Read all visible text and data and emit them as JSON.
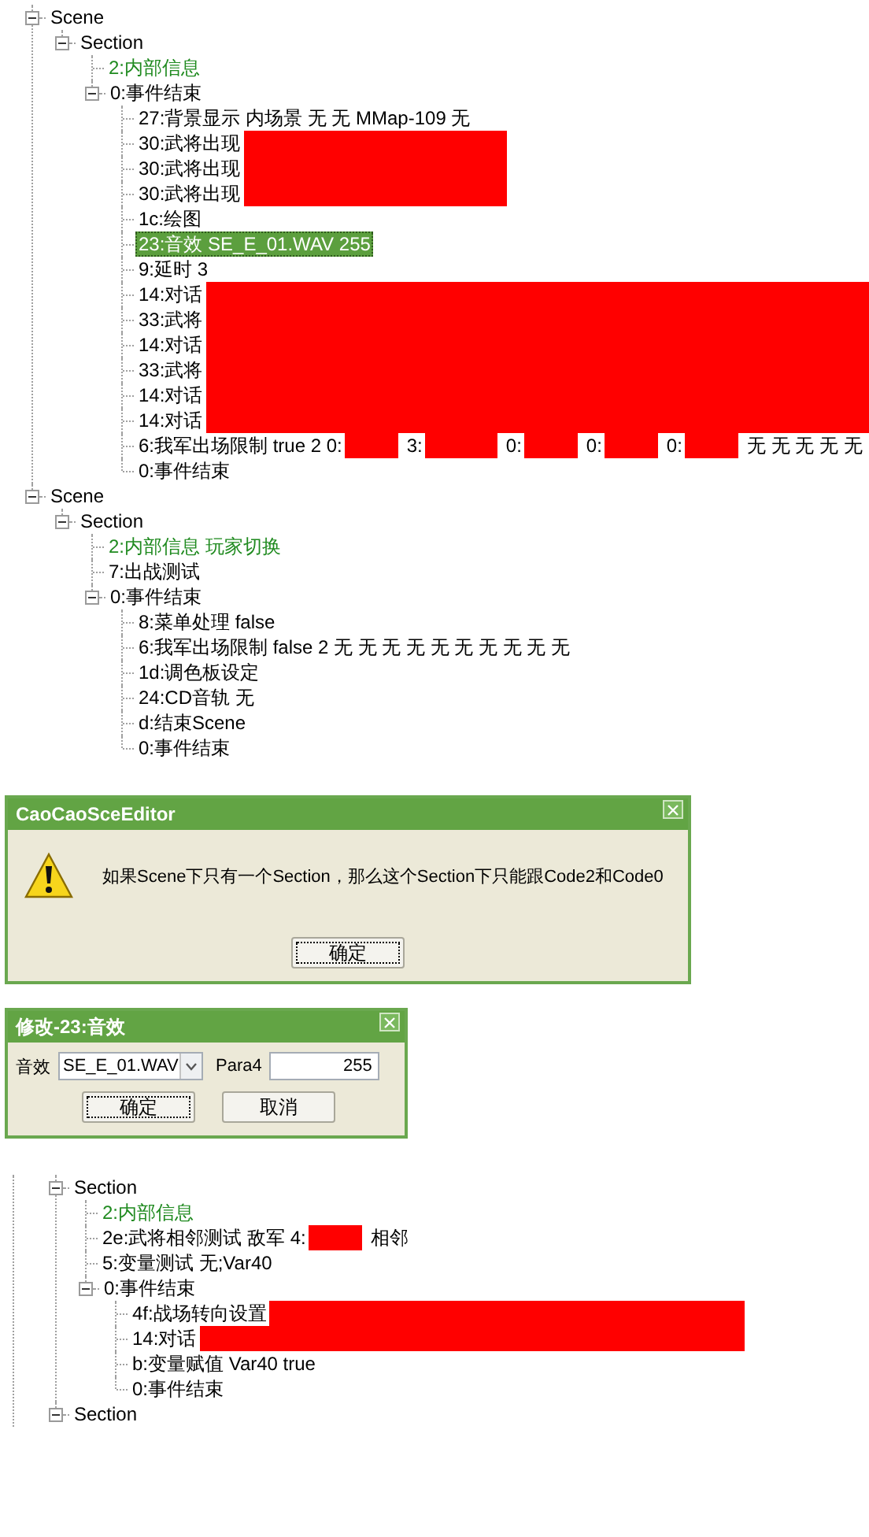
{
  "tree": {
    "nodes": [
      {
        "label": "Scene",
        "selected": false,
        "expanded": true,
        "children": [
          {
            "label": "Section",
            "selected": false,
            "expanded": true,
            "children": [
              {
                "label": "2:内部信息",
                "selected": false,
                "color": "#1f8a1f"
              },
              {
                "label": "0:事件结束",
                "selected": false,
                "expanded": true,
                "children": [
                  {
                    "label": "27:背景显示 内场景 无 无 MMap-109 无",
                    "selected": false
                  },
                  {
                    "label": "30:武将出现",
                    "selected": false,
                    "redacted": true,
                    "kind": "block"
                  },
                  {
                    "label": "30:武将出现",
                    "selected": false,
                    "redacted": true,
                    "kind": "block"
                  },
                  {
                    "label": "30:武将出现",
                    "selected": false,
                    "redacted": true,
                    "kind": "block"
                  },
                  {
                    "label": "1c:绘图",
                    "selected": false
                  },
                  {
                    "label": "23:音效 SE_E_01.WAV 255",
                    "selected": true
                  },
                  {
                    "label": "9:延时 3",
                    "selected": false
                  },
                  {
                    "label": "14:对话",
                    "selected": false,
                    "redacted": true,
                    "kind": "wide"
                  },
                  {
                    "label": "33:武将",
                    "selected": false,
                    "redacted": true,
                    "kind": "wide"
                  },
                  {
                    "label": "14:对话",
                    "selected": false,
                    "redacted": true,
                    "kind": "wide"
                  },
                  {
                    "label": "33:武将",
                    "selected": false,
                    "redacted": true,
                    "kind": "wide"
                  },
                  {
                    "label": "14:对话",
                    "selected": false,
                    "redacted": true,
                    "kind": "wide"
                  },
                  {
                    "label": "14:对话",
                    "selected": false,
                    "redacted": true,
                    "kind": "wide"
                  },
                  {
                    "segments": [
                      {
                        "label": "6:我军出场限制 true 2 0:",
                        "redacted": true,
                        "kind": "short"
                      },
                      {
                        "label": "3:",
                        "redacted": true,
                        "kind": "medium"
                      },
                      {
                        "label": "0:",
                        "redacted": true,
                        "kind": "short"
                      },
                      {
                        "label": "0:",
                        "redacted": true,
                        "kind": "short"
                      },
                      {
                        "label": "0:",
                        "redacted": true,
                        "kind": "short"
                      },
                      {
                        "label": "无 无 无 无 无",
                        "redacted": false
                      }
                    ],
                    "selected": false
                  },
                  {
                    "label": "0:事件结束",
                    "selected": false
                  }
                ]
              }
            ]
          }
        ]
      },
      {
        "label": "Scene",
        "selected": false,
        "expanded": true,
        "children": [
          {
            "label": "Section",
            "selected": false,
            "expanded": true,
            "children": [
              {
                "label": "2:内部信息 玩家切换",
                "selected": false,
                "color": "#1f8a1f"
              },
              {
                "label": "7:出战测试",
                "selected": false
              },
              {
                "label": "0:事件结束",
                "selected": false,
                "expanded": true,
                "children": [
                  {
                    "label": "8:菜单处理 false",
                    "selected": false
                  },
                  {
                    "label": "6:我军出场限制 false 2 无 无 无 无 无 无 无 无 无 无",
                    "selected": false
                  },
                  {
                    "label": "1d:调色板设定",
                    "selected": false
                  },
                  {
                    "label": "24:CD音轨 无",
                    "selected": false
                  },
                  {
                    "label": "d:结束Scene",
                    "selected": false
                  },
                  {
                    "label": "0:事件结束",
                    "selected": false
                  }
                ]
              }
            ]
          }
        ]
      }
    ]
  },
  "alert_dialog": {
    "title": "CaoCaoSceEditor",
    "message": "如果Scene下只有一个Section，那么这个Section下只能跟Code2和Code0",
    "buttons": [
      {
        "label": "确定",
        "focused": true
      }
    ]
  },
  "edit_dialog": {
    "title": "修改-23:音效",
    "fields": [
      {
        "kind": "select",
        "label": "音效",
        "value": "SE_E_01.WAV"
      },
      {
        "kind": "text",
        "label": "Para4",
        "value": "255"
      }
    ],
    "buttons": [
      {
        "label": "确定",
        "focused": true
      },
      {
        "label": "取消",
        "focused": false
      }
    ]
  },
  "tree_2": {
    "nodes": [
      {
        "label": "Section",
        "selected": false,
        "expanded": true,
        "children": [
          {
            "label": "2:内部信息",
            "selected": false,
            "color": "#1f8a1f"
          },
          {
            "segments": [
              {
                "label": "2e:武将相邻测试 敌军 4:",
                "redacted": true
              },
              {
                "label": "相邻",
                "redacted": false
              }
            ],
            "selected": false
          },
          {
            "label": "5:变量测试 无;Var40",
            "selected": false
          },
          {
            "label": "0:事件结束",
            "selected": false,
            "expanded": true,
            "children": [
              {
                "label": "4f:战场转向设置",
                "selected": false,
                "redacted": true,
                "kind": "wide"
              },
              {
                "label": "14:对话",
                "selected": false,
                "redacted": true,
                "kind": "wide"
              },
              {
                "label": "b:变量赋值 Var40 true",
                "selected": false
              },
              {
                "label": "0:事件结束",
                "selected": false
              }
            ]
          }
        ]
      },
      {
        "label": "Section",
        "selected": false,
        "expanded": true
      }
    ]
  }
}
